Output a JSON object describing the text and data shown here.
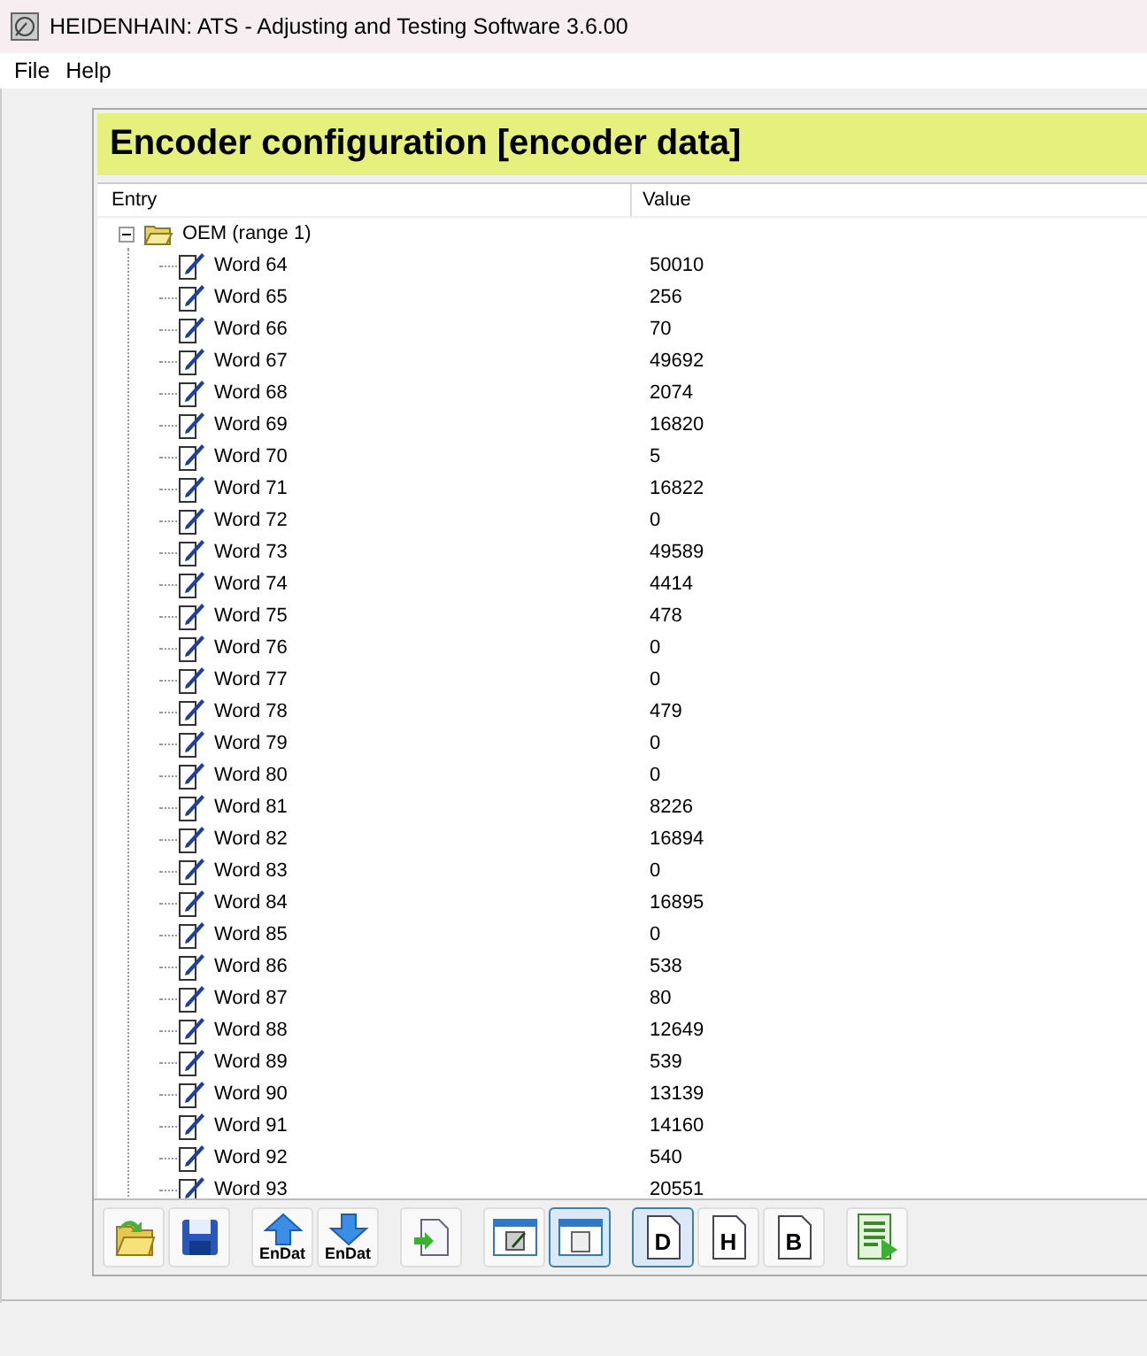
{
  "window": {
    "title": "HEIDENHAIN: ATS - Adjusting and Testing Software 3.6.00"
  },
  "menu": [
    "File",
    "Help"
  ],
  "panel": {
    "title": "Encoder configuration [encoder data]",
    "columns": [
      "Entry",
      "Value"
    ],
    "tree": [
      {
        "label": "OEM (range 1)",
        "expanded": true,
        "children": [
          {
            "label": "Word 64",
            "value": "50010"
          },
          {
            "label": "Word 65",
            "value": "256"
          },
          {
            "label": "Word 66",
            "value": "70"
          },
          {
            "label": "Word 67",
            "value": "49692"
          },
          {
            "label": "Word 68",
            "value": "2074"
          },
          {
            "label": "Word 69",
            "value": "16820"
          },
          {
            "label": "Word 70",
            "value": "5"
          },
          {
            "label": "Word 71",
            "value": "16822"
          },
          {
            "label": "Word 72",
            "value": "0"
          },
          {
            "label": "Word 73",
            "value": "49589"
          },
          {
            "label": "Word 74",
            "value": "4414"
          },
          {
            "label": "Word 75",
            "value": "478"
          },
          {
            "label": "Word 76",
            "value": "0"
          },
          {
            "label": "Word 77",
            "value": "0"
          },
          {
            "label": "Word 78",
            "value": "479"
          },
          {
            "label": "Word 79",
            "value": "0"
          },
          {
            "label": "Word 80",
            "value": "0"
          },
          {
            "label": "Word 81",
            "value": "8226"
          },
          {
            "label": "Word 82",
            "value": "16894"
          },
          {
            "label": "Word 83",
            "value": "0"
          },
          {
            "label": "Word 84",
            "value": "16895"
          },
          {
            "label": "Word 85",
            "value": "0"
          },
          {
            "label": "Word 86",
            "value": "538"
          },
          {
            "label": "Word 87",
            "value": "80"
          },
          {
            "label": "Word 88",
            "value": "12649"
          },
          {
            "label": "Word 89",
            "value": "539"
          },
          {
            "label": "Word 90",
            "value": "13139"
          },
          {
            "label": "Word 91",
            "value": "14160"
          },
          {
            "label": "Word 92",
            "value": "540"
          },
          {
            "label": "Word 93",
            "value": "20551"
          }
        ]
      }
    ],
    "toolbar": [
      [
        {
          "kind": "open",
          "selected": false
        },
        {
          "kind": "save",
          "selected": false
        }
      ],
      [
        {
          "kind": "upload",
          "label": "EnDat",
          "selected": false
        },
        {
          "kind": "download",
          "label": "EnDat",
          "selected": false
        }
      ],
      [
        {
          "kind": "import",
          "selected": false
        }
      ],
      [
        {
          "kind": "view-edit",
          "selected": false
        },
        {
          "kind": "view-page",
          "selected": true
        }
      ],
      [
        {
          "kind": "letter",
          "label": "D",
          "selected": true
        },
        {
          "kind": "letter",
          "label": "H",
          "selected": false
        },
        {
          "kind": "letter",
          "label": "B",
          "selected": false
        }
      ],
      [
        {
          "kind": "run",
          "selected": false
        }
      ]
    ]
  }
}
